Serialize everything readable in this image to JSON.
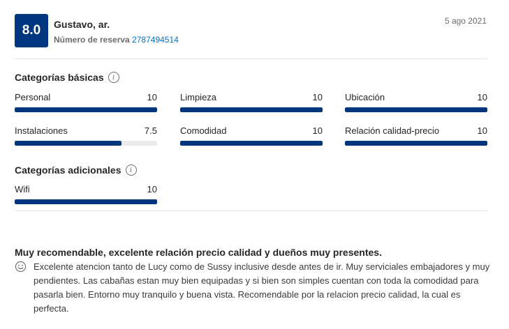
{
  "review": {
    "score": "8.0",
    "reviewer": "Gustavo, ar.",
    "reservation_label": "Número de reserva",
    "reservation_number": "2787494514",
    "date": "5 ago 2021"
  },
  "basic": {
    "title": "Categorías básicas",
    "categories": [
      {
        "label": "Personal",
        "value": "10",
        "score": 10
      },
      {
        "label": "Limpieza",
        "value": "10",
        "score": 10
      },
      {
        "label": "Ubicación",
        "value": "10",
        "score": 10
      },
      {
        "label": "Instalaciones",
        "value": "7.5",
        "score": 7.5
      },
      {
        "label": "Comodidad",
        "value": "10",
        "score": 10
      },
      {
        "label": "Relación calidad-precio",
        "value": "10",
        "score": 10
      }
    ]
  },
  "additional": {
    "title": "Categorías adicionales",
    "categories": [
      {
        "label": "Wifi",
        "value": "10",
        "score": 10
      }
    ]
  },
  "comment": {
    "title": "Muy recomendable, excelente relación precio calidad y dueños muy presentes.",
    "icon": "smile-icon",
    "text": "Excelente atencion tanto de Lucy como de Sussy inclusive desde antes de ir. Muy serviciales embajadores y muy pendientes. Las cabañas estan muy bien equipadas y si bien son simples cuentan con toda la comodidad para pasarla bien. Entorno muy tranquilo y buena vista. Recomendable por la relacion precio calidad, la cual es perfecta."
  },
  "colors": {
    "brand": "#003580",
    "link": "#0071c2"
  }
}
